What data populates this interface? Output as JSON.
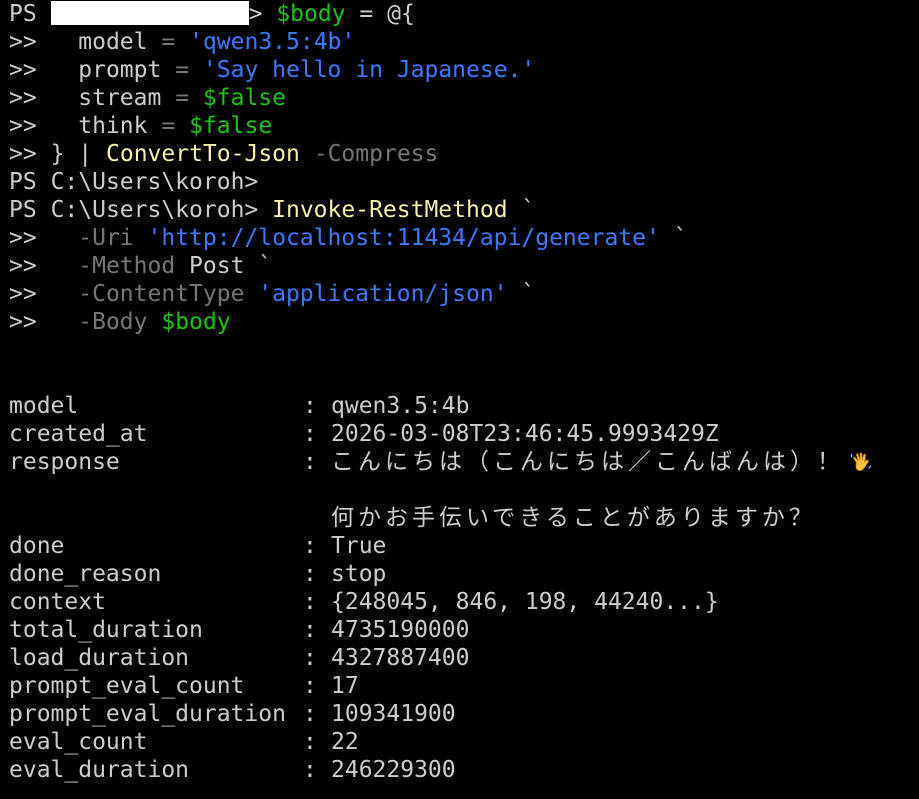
{
  "prompt": {
    "ps": "PS",
    "cwd": "C:\\Users\\koroh>",
    "cont": ">>",
    "gt": ">"
  },
  "cmd1": {
    "var": "$body",
    "eq": "=",
    "open": "@{",
    "fields": [
      {
        "key": "model",
        "eq": "=",
        "value": "'qwen3.5:4b'",
        "kind": "str"
      },
      {
        "key": "prompt",
        "eq": "=",
        "value": "'Say hello in Japanese.'",
        "kind": "str"
      },
      {
        "key": "stream",
        "eq": "=",
        "value": "$false",
        "kind": "var"
      },
      {
        "key": "think",
        "eq": "=",
        "value": "$false",
        "kind": "var"
      }
    ],
    "close": "}",
    "pipe": "|",
    "convert": "ConvertTo-Json",
    "compress": "-Compress"
  },
  "cmd2": {
    "cmdlet": "Invoke-RestMethod",
    "tick": "`",
    "uri_param": "-Uri",
    "uri_value": "'http://localhost:11434/api/generate'",
    "method_param": "-Method",
    "method_value": "Post",
    "ctype_param": "-ContentType",
    "ctype_value": "'application/json'",
    "body_param": "-Body",
    "body_value": "$body"
  },
  "output": {
    "colon": ":",
    "rows": [
      {
        "key": "model",
        "value": "qwen3.5:4b"
      },
      {
        "key": "created_at",
        "value": "2026-03-08T23:46:45.9993429Z"
      },
      {
        "key": "response",
        "value": "こんにちは（こんにちは／こんばんは）！"
      },
      {
        "key": "",
        "value": ""
      },
      {
        "key": "",
        "value": "何かお手伝いできることがありますか？"
      },
      {
        "key": "done",
        "value": "True"
      },
      {
        "key": "done_reason",
        "value": "stop"
      },
      {
        "key": "context",
        "value": "{248045, 846, 198, 44240...}"
      },
      {
        "key": "total_duration",
        "value": "4735190000"
      },
      {
        "key": "load_duration",
        "value": "4327887400"
      },
      {
        "key": "prompt_eval_count",
        "value": "17"
      },
      {
        "key": "prompt_eval_duration",
        "value": "109341900"
      },
      {
        "key": "eval_count",
        "value": "22"
      },
      {
        "key": "eval_duration",
        "value": "246229300"
      }
    ]
  },
  "icons": {
    "response_emoji": "waving-hand-icon"
  },
  "colors": {
    "background": "#000000",
    "default_text": "#cccccc",
    "variable": "#16c60c",
    "string": "#3b78ff",
    "command": "#f9f1a5",
    "parameter": "#767676"
  }
}
